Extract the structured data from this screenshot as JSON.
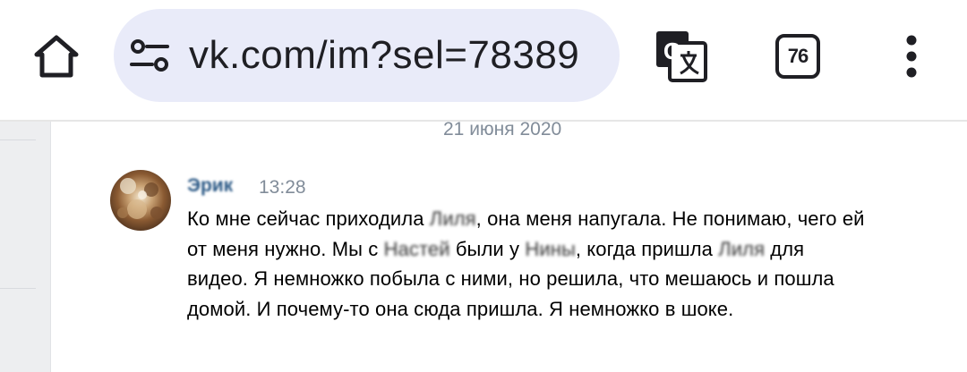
{
  "browser": {
    "url": "vk.com/im?sel=78389",
    "tab_count": "76",
    "icons": {
      "home": "home-icon",
      "site_settings": "tune-icon",
      "translate": "translate-icon",
      "tabs": "tab-switcher-icon",
      "menu": "more-vert-icon"
    }
  },
  "chat": {
    "date_separator": "21 июня 2020",
    "message": {
      "sender": "Эрик",
      "time": "13:28",
      "text_parts": [
        "Ко мне сейчас приходила ",
        "Лиля",
        ", она меня напугала. Не понимаю, чего ей от меня нужно. Мы с ",
        "Настей",
        " были у ",
        "Нины",
        ", когда пришла ",
        "Лиля",
        " для видео. Я немножко побыла с ними, но решила, что мешаюсь и пошла домой. И почему-то она сюда пришла. Я немножко в шоке."
      ]
    }
  },
  "colors": {
    "url_bar_bg": "#e9ebf9",
    "chat_bg": "#edeef0",
    "sender_link": "#2a5885",
    "meta_gray": "#818c99"
  }
}
